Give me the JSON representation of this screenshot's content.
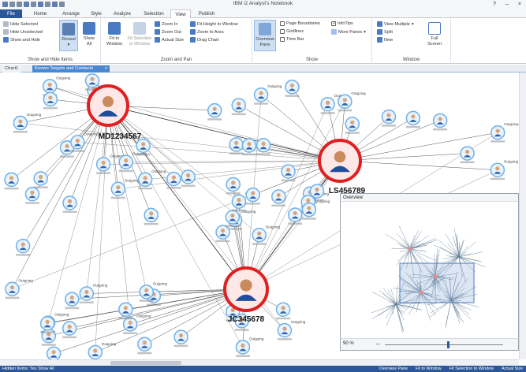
{
  "window": {
    "title": "IBM i2 Analyst's Notebook",
    "help": "?",
    "minimize": "–",
    "close": "×"
  },
  "tabs": [
    "File",
    "Home",
    "Arrange",
    "Style",
    "Analyze",
    "Selection",
    "View",
    "Publish"
  ],
  "active_tab": "View",
  "ribbon": {
    "show_hide": {
      "title": "Show and Hide Items",
      "hide_selected": "Hide Selected",
      "hide_unselected": "Hide Unselected",
      "show_and_hide": "Show and Hide",
      "reveal": "Reveal",
      "show_all_1": "Show",
      "show_all_2": "All"
    },
    "zoom_pan": {
      "title": "Zoom and Pan",
      "fit_to_window_1": "Fit to",
      "fit_to_window_2": "Window",
      "fit_selection_1": "Fit Selection",
      "fit_selection_2": "to Window",
      "zoom_in": "Zoom In",
      "zoom_out": "Zoom Out",
      "actual_size": "Actual Size",
      "fit_height": "Fit Height to Window",
      "zoom_to_area": "Zoom to Area",
      "drag_chart": "Drag Chart"
    },
    "show": {
      "title": "Show",
      "overview_pane_1": "Overview",
      "overview_pane_2": "Pane",
      "page_boundaries": "Page Boundaries",
      "gridlines": "Gridlines",
      "time_bar": "Time Bar",
      "infotips": "InfoTips",
      "more_panes": "More Panes"
    },
    "window": {
      "title": "Window",
      "view_multiple": "View Multiple",
      "split": "Split",
      "new": "New",
      "full_screen_1": "Full",
      "full_screen_2": "Screen"
    }
  },
  "doc_tabs": [
    "Chart1",
    "Known Targets and Contacts"
  ],
  "chart": {
    "main_entities": [
      "MD1234567",
      "LS456789",
      "JC345678"
    ],
    "link_label": "Outgoing"
  },
  "overview": {
    "title": "Overview",
    "zoom": "90 %",
    "zoom_fraction": 0.53
  },
  "status": {
    "left": "Hidden Items: Yes   Show All",
    "overview_pane": "Overview Pane",
    "fit_to_window": "Fit to Window",
    "fit_selection": "Fit Selection to Window",
    "actual_size": "Actual Size"
  },
  "colors": {
    "accent": "#2b579a",
    "entity_ring": "#e02020",
    "node_ring": "#6fb0e8"
  }
}
